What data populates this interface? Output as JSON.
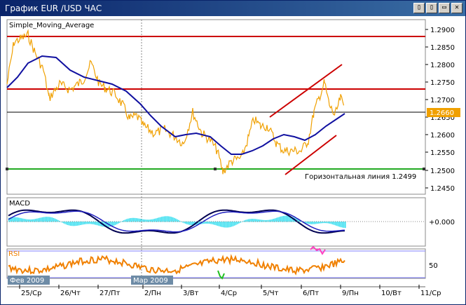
{
  "window": {
    "title": "График EUR /USD  ЧАС",
    "buttons": [
      "▯",
      "▯",
      "▭",
      "✕"
    ]
  },
  "indicators": {
    "sma_label": "Simple_Moving_Average",
    "macd_label": "MACD",
    "rsi_label": "RSI",
    "macd_zero_label": "+0.000",
    "rsi_mid_label": "50"
  },
  "price_axis": {
    "labels": [
      "1.2900",
      "1.2850",
      "1.2800",
      "1.2750",
      "1.2700",
      "1.2650",
      "1.2600",
      "1.2550",
      "1.2500",
      "1.2450"
    ],
    "current_price": "1.2660"
  },
  "annotations": {
    "horizontal_line_label": "Горизонтальная линия 1.2499"
  },
  "time_axis": {
    "labels": [
      "25/Ср",
      "26/Чт",
      "27/Пт",
      "2/Пн",
      "3/Вт",
      "4/Ср",
      "5/Чт",
      "6/Пт",
      "9/Пн",
      "10/Вт",
      "11/Ср"
    ],
    "month_badges": [
      "Фев 2009",
      "Мар 2009"
    ]
  },
  "colors": {
    "price": "#f0a000",
    "sma": "#1010a0",
    "resistance": "#cc0000",
    "support": "#22aa22",
    "macd_hist": "#40e0f0",
    "macd_line": "#000040",
    "rsi": "#f08000",
    "current_price_bg": "#f0a000"
  }
}
